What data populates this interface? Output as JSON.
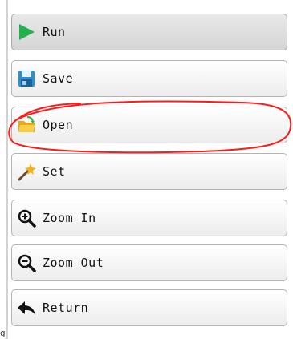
{
  "toolbar": {
    "buttons": [
      {
        "label": "Run",
        "icon": "run-icon",
        "state": "pressed"
      },
      {
        "label": "Save",
        "icon": "save-icon"
      },
      {
        "label": "Open",
        "icon": "open-folder-icon",
        "annotated": true
      },
      {
        "label": "Set",
        "icon": "wand-icon"
      },
      {
        "label": "Zoom In",
        "icon": "zoom-in-icon"
      },
      {
        "label": "Zoom Out",
        "icon": "zoom-out-icon"
      },
      {
        "label": "Return",
        "icon": "return-arrow-icon"
      }
    ]
  },
  "edge_text": "g",
  "colors": {
    "run_green": "#22b14c",
    "annotation_red": "#ff1a1a",
    "active_bg": "#dcdcdc"
  }
}
